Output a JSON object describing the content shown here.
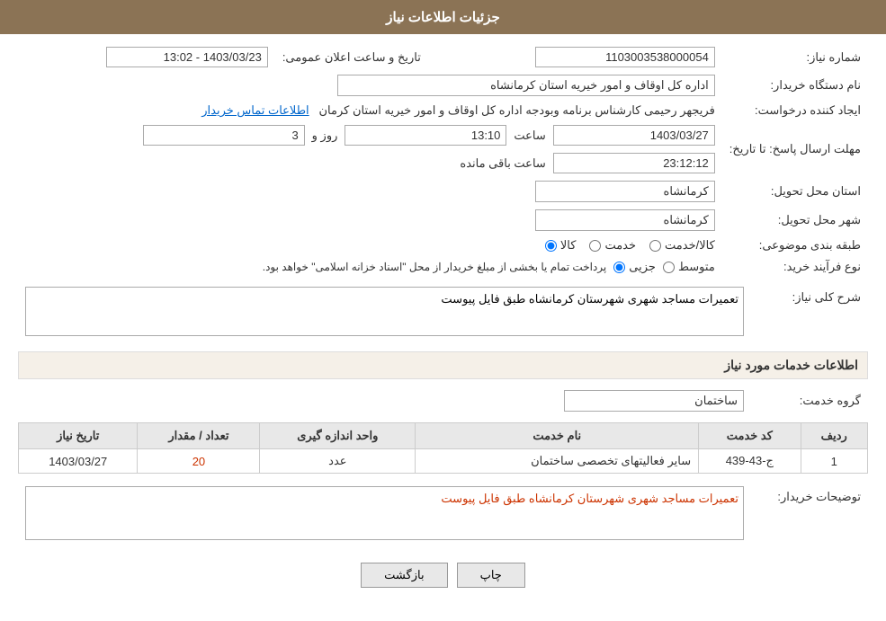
{
  "header": {
    "title": "جزئیات اطلاعات نیاز"
  },
  "fields": {
    "need_number_label": "شماره نیاز:",
    "need_number_value": "1103003538000054",
    "announce_date_label": "تاریخ و ساعت اعلان عمومی:",
    "announce_date_value": "1403/03/23 - 13:02",
    "buyer_org_label": "نام دستگاه خریدار:",
    "buyer_org_value": "اداره کل اوقاف و امور خیریه استان کرمانشاه",
    "creator_label": "ایجاد کننده درخواست:",
    "creator_value": "فریجهر رحیمی کارشناس برنامه وبودجه اداره کل اوقاف و امور خیریه استان کرمان",
    "creator_link": "اطلاعات تماس خریدار",
    "deadline_label": "مهلت ارسال پاسخ: تا تاریخ:",
    "deadline_date": "1403/03/27",
    "deadline_time_label": "ساعت",
    "deadline_time": "13:10",
    "deadline_days_label": "روز و",
    "deadline_days": "3",
    "deadline_remaining_label": "ساعت باقی مانده",
    "deadline_remaining": "23:12:12",
    "province_label": "استان محل تحویل:",
    "province_value": "کرمانشاه",
    "city_label": "شهر محل تحویل:",
    "city_value": "کرمانشاه",
    "category_label": "طبقه بندی موضوعی:",
    "category_kala": "کالا",
    "category_khadamat": "خدمت",
    "category_kala_khadamat": "کالا/خدمت",
    "purchase_type_label": "نوع فرآیند خرید:",
    "purchase_type_jazii": "جزیی",
    "purchase_type_moutasat": "متوسط",
    "purchase_type_note": "پرداخت تمام یا بخشی از مبلغ خریدار از محل \"اسناد خزانه اسلامی\" خواهد بود.",
    "need_desc_label": "شرح کلی نیاز:",
    "need_desc_value": "تعمیرات مساجد شهری شهرستان کرمانشاه طبق فایل پیوست",
    "services_label": "اطلاعات خدمات مورد نیاز",
    "service_group_label": "گروه خدمت:",
    "service_group_value": "ساختمان",
    "table": {
      "headers": [
        "ردیف",
        "کد خدمت",
        "نام خدمت",
        "واحد اندازه گیری",
        "تعداد / مقدار",
        "تاریخ نیاز"
      ],
      "rows": [
        {
          "row": "1",
          "code": "ج-43-439",
          "name": "سایر فعالیتهای تخصصی ساختمان",
          "unit": "عدد",
          "quantity": "20",
          "date": "1403/03/27"
        }
      ]
    },
    "buyer_desc_label": "توضیحات خریدار:",
    "buyer_desc_value": "تعمیرات مساجد شهری شهرستان کرمانشاه طبق فایل پیوست"
  },
  "buttons": {
    "print": "چاپ",
    "back": "بازگشت"
  }
}
